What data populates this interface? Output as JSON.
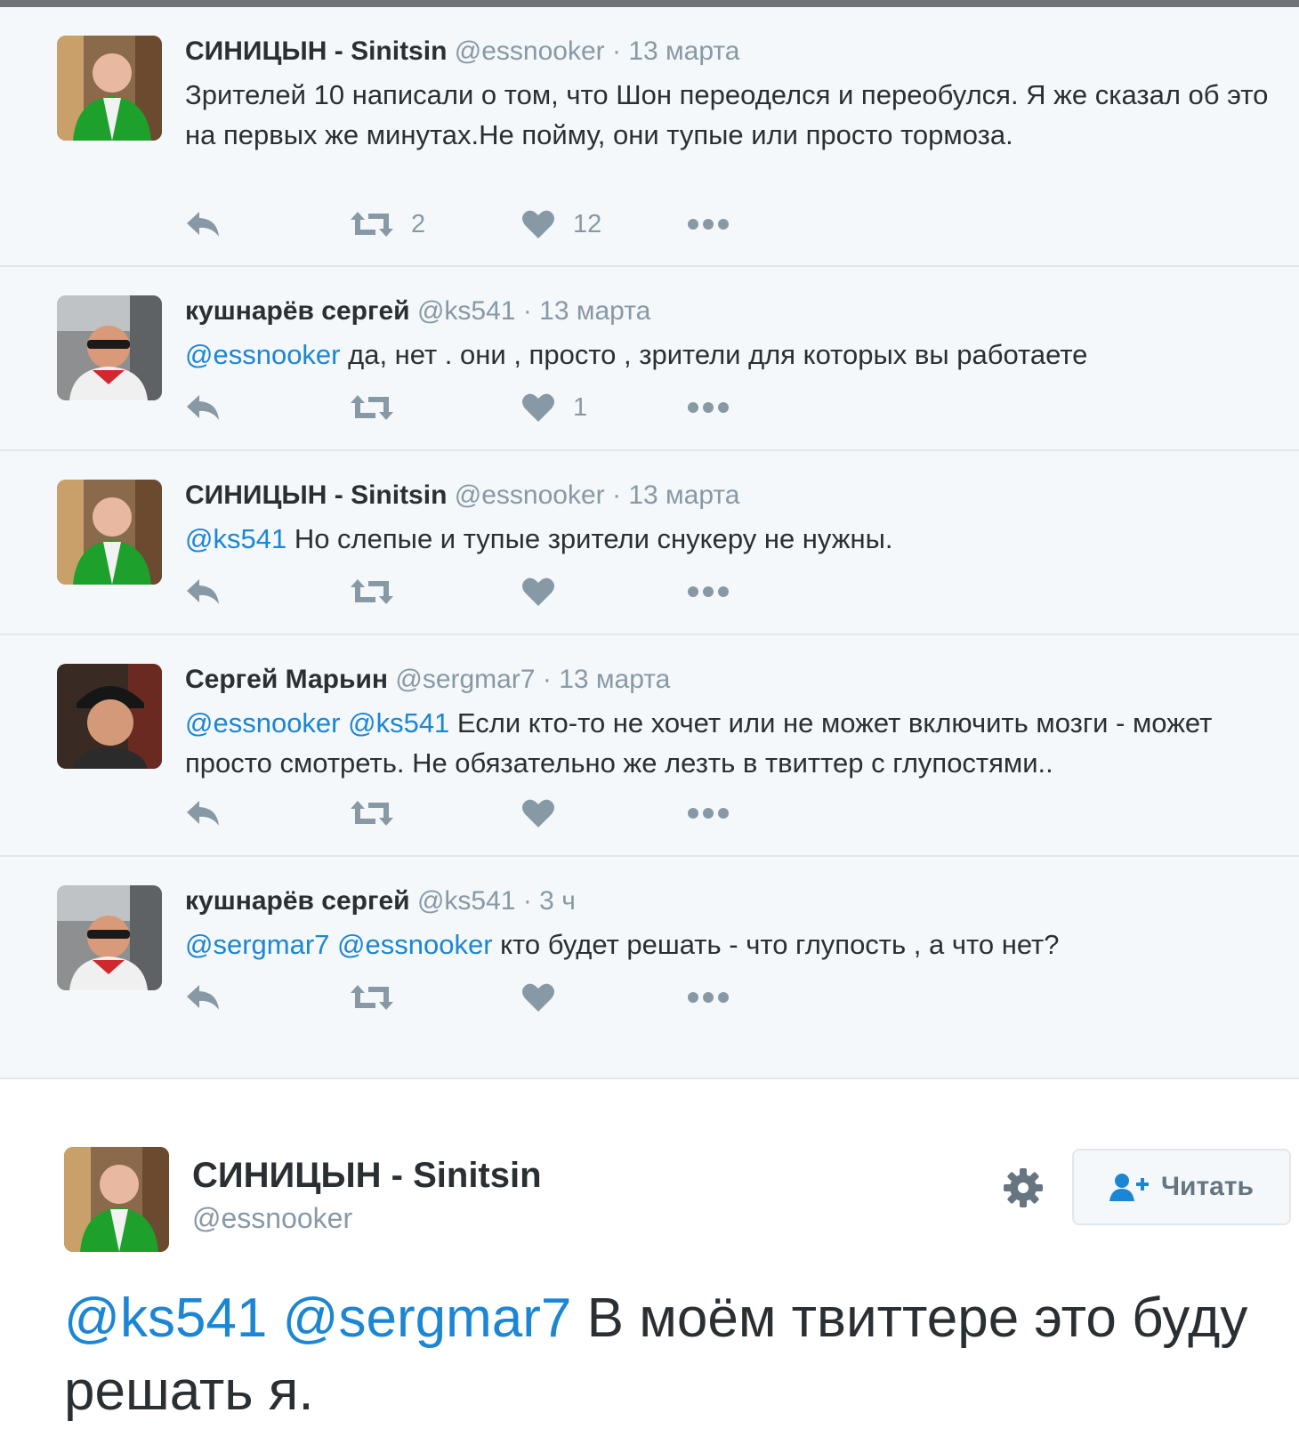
{
  "colors": {
    "accent": "#1b86d4",
    "muted": "#8899a6",
    "text": "#292f33",
    "thread_bg": "#f5f8fa"
  },
  "action_icons": [
    "reply-icon",
    "retweet-icon",
    "like-icon",
    "more-icon"
  ],
  "thread": [
    {
      "name": "СИНИЦЫН - Sinitsin",
      "handle": "@essnooker",
      "sep": "·",
      "time": "13 марта",
      "mentions": "",
      "text": "Зрителей 10 написали о том, что Шон переоделся и переобулся. Я же сказал об это на первых же минутах.Не пойму, они тупые или просто тормоза.",
      "retweets": "2",
      "likes": "12"
    },
    {
      "name": "кушнарёв сергей",
      "handle": "@ks541",
      "sep": "·",
      "time": "13 марта",
      "mentions": "@essnooker",
      "text": " да, нет . они , просто , зрители для которых вы работаете",
      "retweets": "",
      "likes": "1"
    },
    {
      "name": "СИНИЦЫН - Sinitsin",
      "handle": "@essnooker",
      "sep": "·",
      "time": "13 марта",
      "mentions": "@ks541",
      "text": " Но слепые и тупые зрители снукеру не нужны.",
      "retweets": "",
      "likes": ""
    },
    {
      "name": "Сергей Марьин",
      "handle": "@sergmar7",
      "sep": "·",
      "time": "13 марта",
      "mentions": "@essnooker @ks541",
      "text": " Если кто-то не хочет или не может включить мозги - может просто смотреть. Не обязательно же лезть в твиттер с глупостями..",
      "retweets": "",
      "likes": ""
    },
    {
      "name": "кушнарёв сергей",
      "handle": "@ks541",
      "sep": "·",
      "time": "3 ч",
      "mentions": "@sergmar7 @essnooker",
      "text": " кто будет решать - что глупость , а что нет?",
      "retweets": "",
      "likes": ""
    }
  ],
  "main_tweet": {
    "name": "СИНИЦЫН - Sinitsin",
    "handle": "@essnooker",
    "follow_label": "Читать",
    "mentions": "@ks541 @sergmar7",
    "text": " В моём твиттере это буду решать я."
  }
}
